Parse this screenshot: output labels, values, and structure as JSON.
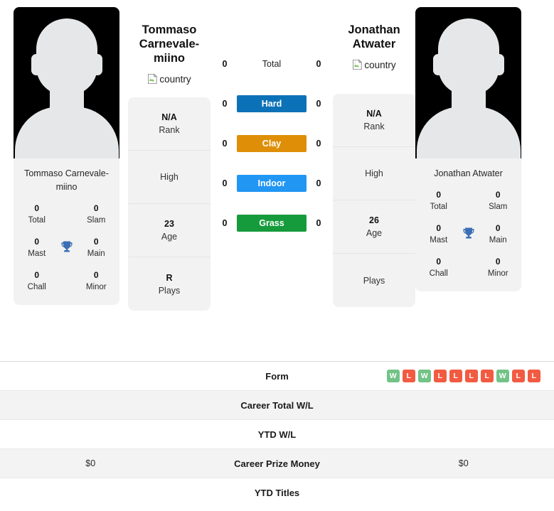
{
  "players": {
    "left": {
      "display_name_line1": "Tommaso",
      "display_name_line2": "Carnevale-miino",
      "country_alt": "country",
      "photo_caption": "Tommaso Carnevale-miino",
      "trophies": {
        "total": "0",
        "total_label": "Total",
        "slam": "0",
        "slam_label": "Slam",
        "mast": "0",
        "mast_label": "Mast",
        "main": "0",
        "main_label": "Main",
        "chall": "0",
        "chall_label": "Chall",
        "minor": "0",
        "minor_label": "Minor"
      },
      "info": {
        "rank_value": "N/A",
        "rank_label": "Rank",
        "high_value": "",
        "high_label": "High",
        "age_value": "23",
        "age_label": "Age",
        "plays_value": "R",
        "plays_label": "Plays"
      }
    },
    "right": {
      "display_name_line1": "Jonathan",
      "display_name_line2": "Atwater",
      "country_alt": "country",
      "photo_caption": "Jonathan Atwater",
      "trophies": {
        "total": "0",
        "total_label": "Total",
        "slam": "0",
        "slam_label": "Slam",
        "mast": "0",
        "mast_label": "Mast",
        "main": "0",
        "main_label": "Main",
        "chall": "0",
        "chall_label": "Chall",
        "minor": "0",
        "minor_label": "Minor"
      },
      "info": {
        "rank_value": "N/A",
        "rank_label": "Rank",
        "high_value": "",
        "high_label": "High",
        "age_value": "26",
        "age_label": "Age",
        "plays_value": "",
        "plays_label": "Plays"
      }
    }
  },
  "surfaces": [
    {
      "label": "Total",
      "left": "0",
      "right": "0",
      "color": "transparent",
      "plain": true
    },
    {
      "label": "Hard",
      "left": "0",
      "right": "0",
      "color": "#0c72b8",
      "plain": false
    },
    {
      "label": "Clay",
      "left": "0",
      "right": "0",
      "color": "#df8f07",
      "plain": false
    },
    {
      "label": "Indoor",
      "left": "0",
      "right": "0",
      "color": "#2196f3",
      "plain": false
    },
    {
      "label": "Grass",
      "left": "0",
      "right": "0",
      "color": "#169b3c",
      "plain": false
    }
  ],
  "bottom_rows": [
    {
      "label": "Form",
      "left_text": "",
      "right_text": "",
      "striped": false,
      "left_form": [],
      "right_form": [
        "W",
        "L",
        "W",
        "L",
        "L",
        "L",
        "L",
        "W",
        "L",
        "L"
      ]
    },
    {
      "label": "Career Total W/L",
      "left_text": "",
      "right_text": "",
      "striped": true,
      "left_form": [],
      "right_form": []
    },
    {
      "label": "YTD W/L",
      "left_text": "",
      "right_text": "",
      "striped": false,
      "left_form": [],
      "right_form": []
    },
    {
      "label": "Career Prize Money",
      "left_text": "$0",
      "right_text": "$0",
      "striped": true,
      "left_form": [],
      "right_form": []
    },
    {
      "label": "YTD Titles",
      "left_text": "",
      "right_text": "",
      "striped": false,
      "left_form": [],
      "right_form": []
    }
  ],
  "colors": {
    "win_badge": "#72c387",
    "loss_badge": "#f15b42",
    "trophy": "#3b6fb5",
    "card_bg": "#f2f2f2"
  },
  "icons": {
    "trophy": "trophy-icon",
    "broken_image": "broken-image-icon"
  }
}
